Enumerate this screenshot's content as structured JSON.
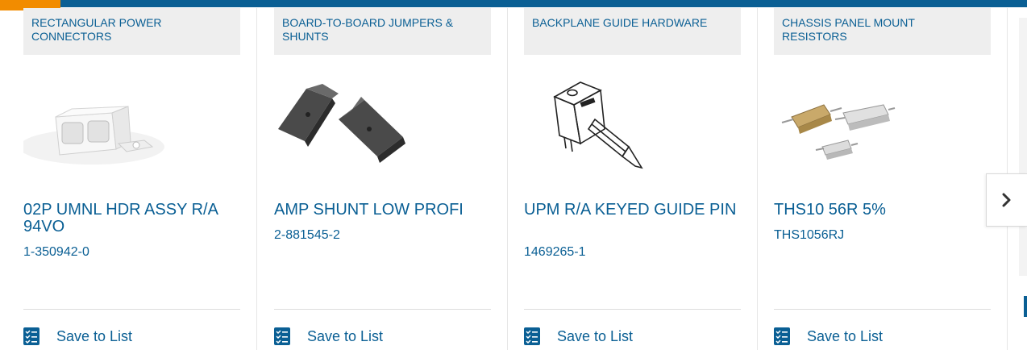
{
  "colors": {
    "brand_blue": "#0a5f94",
    "accent_orange": "#f28c00",
    "category_bg": "#eeeeee"
  },
  "save_label": "Save to List",
  "products": [
    {
      "category": "RECTANGULAR POWER CONNECTORS",
      "name": "02P UMNL HDR ASSY R/A 94VO",
      "part_number": "1-350942-0",
      "image_icon": "rectangular-power-connector-image"
    },
    {
      "category": "BOARD-TO-BOARD JUMPERS & SHUNTS",
      "name": "AMP SHUNT LOW PROFI",
      "part_number": "2-881545-2",
      "image_icon": "shunt-jumper-image"
    },
    {
      "category": "BACKPLANE GUIDE HARDWARE",
      "name": "UPM R/A KEYED GUIDE PIN",
      "part_number": "1469265-1",
      "image_icon": "guide-pin-image"
    },
    {
      "category": "CHASSIS PANEL MOUNT RESISTORS",
      "name": "THS10 56R 5%",
      "part_number": "THS1056RJ",
      "image_icon": "panel-mount-resistor-image"
    }
  ],
  "carousel": {
    "next_icon": "chevron-right-icon"
  }
}
